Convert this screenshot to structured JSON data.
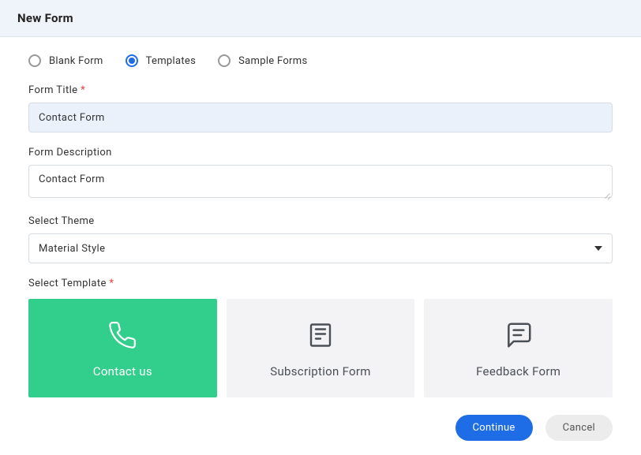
{
  "header": {
    "title": "New Form"
  },
  "formType": {
    "options": [
      {
        "id": "blank",
        "label": "Blank Form",
        "selected": false
      },
      {
        "id": "templates",
        "label": "Templates",
        "selected": true
      },
      {
        "id": "sample",
        "label": "Sample Forms",
        "selected": false
      }
    ]
  },
  "fields": {
    "title": {
      "label": "Form Title",
      "required": true,
      "value": "Contact Form"
    },
    "description": {
      "label": "Form Description",
      "required": false,
      "value": "Contact Form"
    },
    "theme": {
      "label": "Select Theme",
      "required": false,
      "value": "Material Style"
    },
    "template": {
      "label": "Select Template",
      "required": true
    }
  },
  "templates": [
    {
      "id": "contact",
      "label": "Contact us",
      "icon": "phone-icon",
      "selected": true
    },
    {
      "id": "subscription",
      "label": "Subscription Form",
      "icon": "newspaper-icon",
      "selected": false
    },
    {
      "id": "feedback",
      "label": "Feedback Form",
      "icon": "chat-icon",
      "selected": false
    }
  ],
  "actions": {
    "continue": "Continue",
    "cancel": "Cancel"
  },
  "requiredMark": "*"
}
